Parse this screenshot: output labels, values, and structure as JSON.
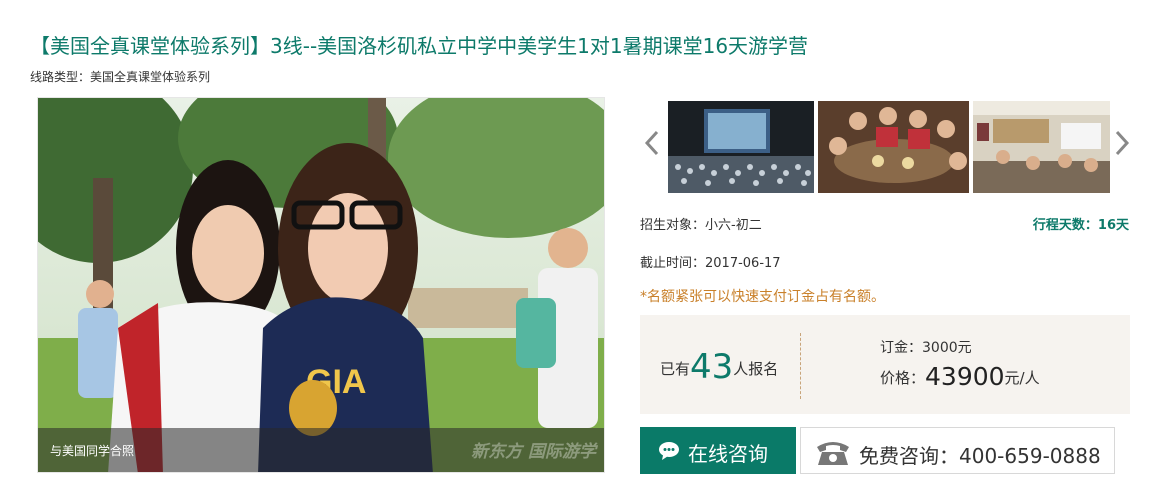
{
  "header": {
    "title": "【美国全真课堂体验系列】3线--美国洛杉矶私立中学中美学生1对1暑期课堂16天游学营",
    "route_type": "线路类型：美国全真课堂体验系列"
  },
  "gallery": {
    "main_caption": "与美国同学合照",
    "watermark": "新东方 国际游学"
  },
  "details": {
    "target": "招生对象：小六-初二",
    "trip_days": "行程天数：16天",
    "deadline": "截止时间：2017-06-17",
    "notice": "*名额紧张可以快速支付订金占有名额。"
  },
  "pricing": {
    "enrolled_prefix": "已有",
    "enrolled_count": "43",
    "enrolled_suffix": "人报名",
    "deposit": "订金：3000元",
    "price_label": "价格：",
    "price_amount": "43900",
    "price_unit": "元/人"
  },
  "actions": {
    "online_consult": "在线咨询",
    "phone_consult": "免费咨询：400-659-0888"
  },
  "colors": {
    "accent": "#0d7a6a",
    "notice": "#c9802a",
    "price_box_bg": "#f6f3ef"
  }
}
